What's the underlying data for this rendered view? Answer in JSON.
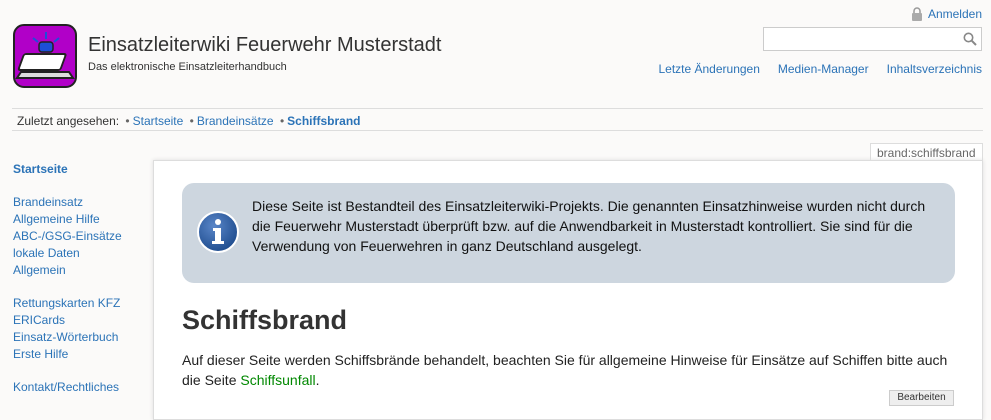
{
  "header": {
    "title": "Einsatzleiterwiki Feuerwehr Musterstadt",
    "tagline": "Das elektronische Einsatzleiterhandbuch",
    "login_label": "Anmelden",
    "search_placeholder": "",
    "tools": [
      "Letzte Änderungen",
      "Medien-Manager",
      "Inhaltsverzeichnis"
    ]
  },
  "breadcrumbs": {
    "label": "Zuletzt angesehen:",
    "items": [
      "Startseite",
      "Brandeinsätze",
      "Schiffsbrand"
    ]
  },
  "sidebar": {
    "home": "Startseite",
    "group1": [
      "Brandeinsatz",
      "Allgemeine Hilfe",
      "ABC-/GSG-Einsätze",
      "lokale Daten",
      "Allgemein"
    ],
    "group2": [
      "Rettungskarten KFZ",
      "ERICards",
      "Einsatz-Wörterbuch",
      "Erste Hilfe"
    ],
    "group3": [
      "Kontakt/Rechtliches"
    ]
  },
  "page": {
    "id": "brand:schiffsbrand",
    "notice": "Diese Seite ist Bestandteil des Einsatzleiterwiki-Projekts. Die genannten Einsatzhinweise wurden nicht durch die Feuerwehr Musterstadt überprüft bzw. auf die Anwendbarkeit in Musterstadt kontrolliert. Sie sind für die Verwendung von Feuerwehren in ganz Deutschland ausgelegt.",
    "title": "Schiffsbrand",
    "intro_before": "Auf dieser Seite werden Schiffsbrände behandelt, beachten Sie für allgemeine Hinweise für Einsätze auf Schiffen bitte auch die Seite ",
    "intro_link": "Schiffsunfall",
    "intro_after": ".",
    "edit_label": "Bearbeiten"
  },
  "colors": {
    "link": "#2b73b7",
    "internal_link": "#008800",
    "notice_bg": "#cdd6df",
    "logo_bg": "#b100c8"
  }
}
